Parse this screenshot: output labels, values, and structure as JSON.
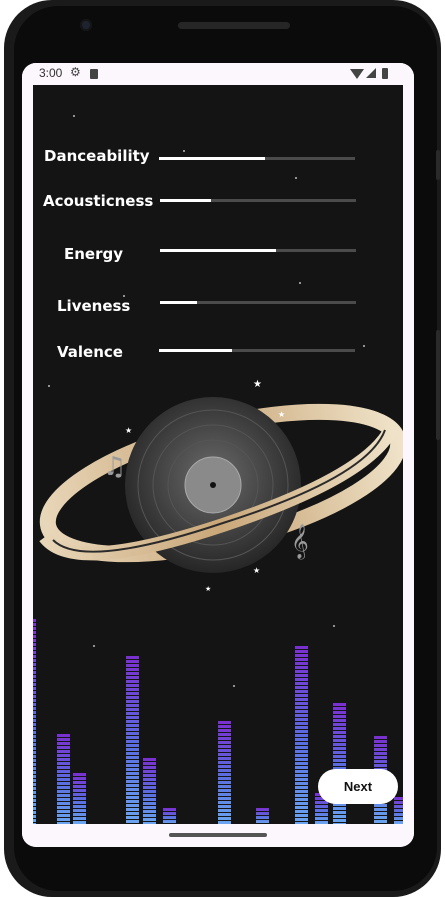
{
  "status_bar": {
    "time": "3:00",
    "icons": [
      "gear-icon",
      "sd-card-icon",
      "wifi-icon",
      "cell-signal-icon",
      "battery-icon"
    ]
  },
  "features": [
    {
      "label": "Danceability",
      "value": 0.54
    },
    {
      "label": "Acousticness",
      "value": 0.26
    },
    {
      "label": "Energy",
      "value": 0.59
    },
    {
      "label": "Liveness",
      "value": 0.19
    },
    {
      "label": "Valence",
      "value": 0.37
    }
  ],
  "decor": {
    "music_note": "♫",
    "treble_clef": "𝄞"
  },
  "equalizer_levels": [
    1.0,
    0.44,
    0.25,
    0.82,
    0.32,
    0.08,
    0.5,
    0.08,
    0.87,
    0.15,
    0.59,
    0.43,
    0.13
  ],
  "next_button": {
    "label": "Next"
  },
  "colors": {
    "background": "#141414",
    "accent_purple": "#7a2fd0",
    "accent_blue": "#6aa4f0",
    "button_bg": "#ffffff"
  }
}
